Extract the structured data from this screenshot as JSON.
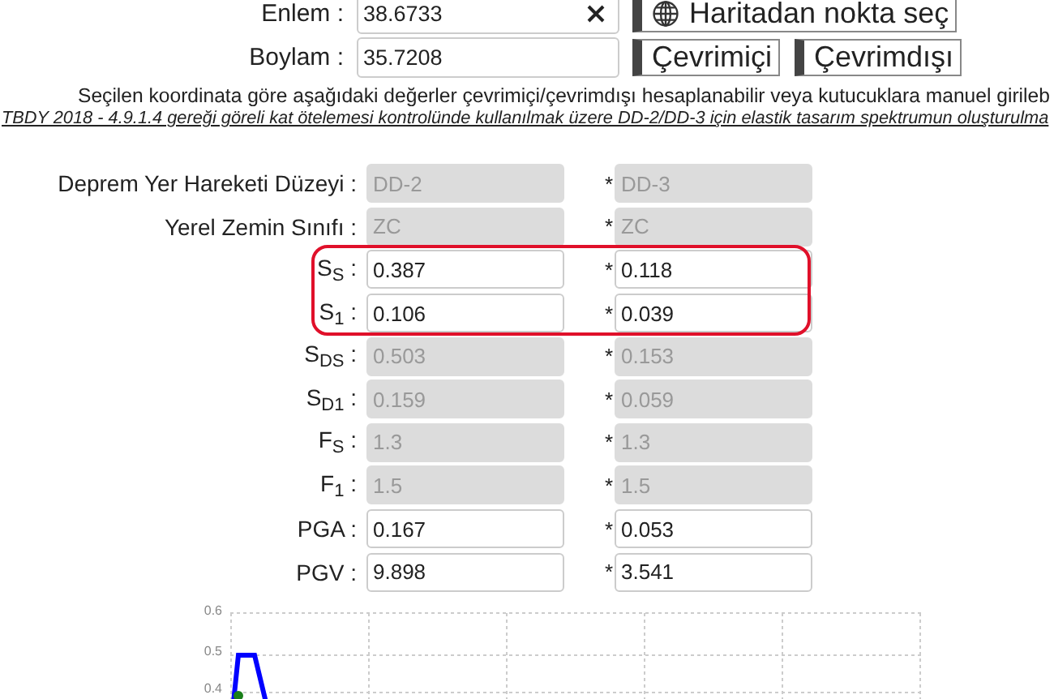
{
  "location": [
    {
      "label": "Enlem :",
      "value": "38.6733",
      "clearable": true,
      "buttons": [
        "Haritadan nokta seç"
      ]
    },
    {
      "label": "Boylam :",
      "value": "35.7208",
      "clearable": false,
      "buttons": [
        "Çevrimiçi",
        "Çevrimdışı"
      ]
    }
  ],
  "notes": [
    {
      "kind": "plain",
      "text": "Seçilen koordinata göre aşağıdaki değerler çevrimiçi/çevrimdışı hesaplanabilir veya kutucuklara manuel girileb"
    },
    {
      "kind": "link",
      "text": "TBDY 2018 - 4.9.1.4 gereği göreli kat ötelemesi kontrolünde kullanılmak üzere DD-2/DD-3 için elastik tasarım spektrumun oluşturulma"
    }
  ],
  "params": [
    {
      "label": "Deprem Yer Hareketi Düzeyi :",
      "highlighted": false,
      "values": [
        {
          "value": "DD-2",
          "disabled": true
        },
        {
          "star": "*",
          "value": "DD-3",
          "disabled": true
        }
      ]
    },
    {
      "label": "Yerel Zemin Sınıfı :",
      "highlighted": false,
      "values": [
        {
          "value": "ZC",
          "disabled": true
        },
        {
          "star": "*",
          "value": "ZC",
          "disabled": true
        }
      ]
    },
    {
      "label": "S$_{S}$ :",
      "highlighted": true,
      "values": [
        {
          "value": "0.387",
          "disabled": false
        },
        {
          "star": "*",
          "value": "0.118",
          "disabled": false
        }
      ]
    },
    {
      "label": "S$_{1}$ :",
      "highlighted": true,
      "values": [
        {
          "value": "0.106",
          "disabled": false
        },
        {
          "star": "*",
          "value": "0.039",
          "disabled": false
        }
      ]
    },
    {
      "label": "S$_{DS}$ :",
      "highlighted": false,
      "values": [
        {
          "value": "0.503",
          "disabled": true
        },
        {
          "star": "*",
          "value": "0.153",
          "disabled": true
        }
      ]
    },
    {
      "label": "S$_{D1}$ :",
      "highlighted": false,
      "values": [
        {
          "value": "0.159",
          "disabled": true
        },
        {
          "star": "*",
          "value": "0.059",
          "disabled": true
        }
      ]
    },
    {
      "label": "F$_{S}$ :",
      "highlighted": false,
      "values": [
        {
          "value": "1.3",
          "disabled": true
        },
        {
          "star": "*",
          "value": "1.3",
          "disabled": true
        }
      ]
    },
    {
      "label": "F$_{1}$ :",
      "highlighted": false,
      "values": [
        {
          "value": "1.5",
          "disabled": true
        },
        {
          "star": "*",
          "value": "1.5",
          "disabled": true
        }
      ]
    },
    {
      "label": "PGA :",
      "highlighted": false,
      "values": [
        {
          "value": "0.167",
          "disabled": false
        },
        {
          "star": "*",
          "value": "0.053",
          "disabled": false
        }
      ]
    },
    {
      "label": "PGV :",
      "highlighted": false,
      "values": [
        {
          "value": "9.898",
          "disabled": false
        },
        {
          "star": "*",
          "value": "3.541",
          "disabled": false
        }
      ]
    }
  ],
  "chart": {
    "y_tick_labels": [
      "0.6",
      "0.5",
      "0.4"
    ]
  }
}
